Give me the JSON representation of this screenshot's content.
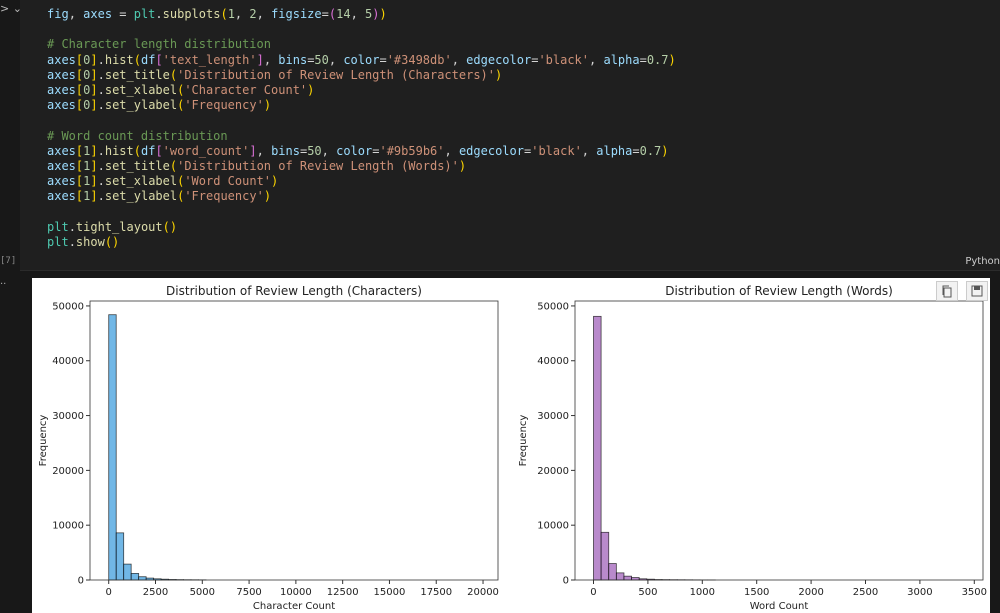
{
  "cell": {
    "execution_count": "[7]",
    "language": "Python",
    "run_glyph": "> ⌄",
    "output_glyph": "..",
    "code_lines": [
      [
        [
          "fig",
          "t-var"
        ],
        [
          ", ",
          "t-op"
        ],
        [
          "axes",
          "t-var"
        ],
        [
          " = ",
          "t-op"
        ],
        [
          "plt",
          "t-mod"
        ],
        [
          ".",
          "t-op"
        ],
        [
          "subplots",
          "t-fn"
        ],
        [
          "(",
          "t-b1"
        ],
        [
          "1",
          "t-num"
        ],
        [
          ", ",
          "t-op"
        ],
        [
          "2",
          "t-num"
        ],
        [
          ", ",
          "t-op"
        ],
        [
          "figsize",
          "t-var"
        ],
        [
          "=",
          "t-op"
        ],
        [
          "(",
          "t-b2"
        ],
        [
          "14",
          "t-num"
        ],
        [
          ", ",
          "t-op"
        ],
        [
          "5",
          "t-num"
        ],
        [
          ")",
          "t-b2"
        ],
        [
          ")",
          "t-b1"
        ]
      ],
      [],
      [
        [
          "# Character length distribution",
          "t-com"
        ]
      ],
      [
        [
          "axes",
          "t-var"
        ],
        [
          "[",
          "t-b1"
        ],
        [
          "0",
          "t-num"
        ],
        [
          "]",
          "t-b1"
        ],
        [
          ".",
          "t-op"
        ],
        [
          "hist",
          "t-fn"
        ],
        [
          "(",
          "t-b1"
        ],
        [
          "df",
          "t-var"
        ],
        [
          "[",
          "t-b2"
        ],
        [
          "'text_length'",
          "t-str"
        ],
        [
          "]",
          "t-b2"
        ],
        [
          ", ",
          "t-op"
        ],
        [
          "bins",
          "t-var"
        ],
        [
          "=",
          "t-op"
        ],
        [
          "50",
          "t-num"
        ],
        [
          ", ",
          "t-op"
        ],
        [
          "color",
          "t-var"
        ],
        [
          "=",
          "t-op"
        ],
        [
          "'#3498db'",
          "t-str"
        ],
        [
          ", ",
          "t-op"
        ],
        [
          "edgecolor",
          "t-var"
        ],
        [
          "=",
          "t-op"
        ],
        [
          "'black'",
          "t-str"
        ],
        [
          ", ",
          "t-op"
        ],
        [
          "alpha",
          "t-var"
        ],
        [
          "=",
          "t-op"
        ],
        [
          "0.7",
          "t-num"
        ],
        [
          ")",
          "t-b1"
        ]
      ],
      [
        [
          "axes",
          "t-var"
        ],
        [
          "[",
          "t-b1"
        ],
        [
          "0",
          "t-num"
        ],
        [
          "]",
          "t-b1"
        ],
        [
          ".",
          "t-op"
        ],
        [
          "set_title",
          "t-fn"
        ],
        [
          "(",
          "t-b1"
        ],
        [
          "'Distribution of Review Length (Characters)'",
          "t-str"
        ],
        [
          ")",
          "t-b1"
        ]
      ],
      [
        [
          "axes",
          "t-var"
        ],
        [
          "[",
          "t-b1"
        ],
        [
          "0",
          "t-num"
        ],
        [
          "]",
          "t-b1"
        ],
        [
          ".",
          "t-op"
        ],
        [
          "set_xlabel",
          "t-fn"
        ],
        [
          "(",
          "t-b1"
        ],
        [
          "'Character Count'",
          "t-str"
        ],
        [
          ")",
          "t-b1"
        ]
      ],
      [
        [
          "axes",
          "t-var"
        ],
        [
          "[",
          "t-b1"
        ],
        [
          "0",
          "t-num"
        ],
        [
          "]",
          "t-b1"
        ],
        [
          ".",
          "t-op"
        ],
        [
          "set_ylabel",
          "t-fn"
        ],
        [
          "(",
          "t-b1"
        ],
        [
          "'Frequency'",
          "t-str"
        ],
        [
          ")",
          "t-b1"
        ]
      ],
      [],
      [
        [
          "# Word count distribution",
          "t-com"
        ]
      ],
      [
        [
          "axes",
          "t-var"
        ],
        [
          "[",
          "t-b1"
        ],
        [
          "1",
          "t-num"
        ],
        [
          "]",
          "t-b1"
        ],
        [
          ".",
          "t-op"
        ],
        [
          "hist",
          "t-fn"
        ],
        [
          "(",
          "t-b1"
        ],
        [
          "df",
          "t-var"
        ],
        [
          "[",
          "t-b2"
        ],
        [
          "'word_count'",
          "t-str"
        ],
        [
          "]",
          "t-b2"
        ],
        [
          ", ",
          "t-op"
        ],
        [
          "bins",
          "t-var"
        ],
        [
          "=",
          "t-op"
        ],
        [
          "50",
          "t-num"
        ],
        [
          ", ",
          "t-op"
        ],
        [
          "color",
          "t-var"
        ],
        [
          "=",
          "t-op"
        ],
        [
          "'#9b59b6'",
          "t-str"
        ],
        [
          ", ",
          "t-op"
        ],
        [
          "edgecolor",
          "t-var"
        ],
        [
          "=",
          "t-op"
        ],
        [
          "'black'",
          "t-str"
        ],
        [
          ", ",
          "t-op"
        ],
        [
          "alpha",
          "t-var"
        ],
        [
          "=",
          "t-op"
        ],
        [
          "0.7",
          "t-num"
        ],
        [
          ")",
          "t-b1"
        ]
      ],
      [
        [
          "axes",
          "t-var"
        ],
        [
          "[",
          "t-b1"
        ],
        [
          "1",
          "t-num"
        ],
        [
          "]",
          "t-b1"
        ],
        [
          ".",
          "t-op"
        ],
        [
          "set_title",
          "t-fn"
        ],
        [
          "(",
          "t-b1"
        ],
        [
          "'Distribution of Review Length (Words)'",
          "t-str"
        ],
        [
          ")",
          "t-b1"
        ]
      ],
      [
        [
          "axes",
          "t-var"
        ],
        [
          "[",
          "t-b1"
        ],
        [
          "1",
          "t-num"
        ],
        [
          "]",
          "t-b1"
        ],
        [
          ".",
          "t-op"
        ],
        [
          "set_xlabel",
          "t-fn"
        ],
        [
          "(",
          "t-b1"
        ],
        [
          "'Word Count'",
          "t-str"
        ],
        [
          ")",
          "t-b1"
        ]
      ],
      [
        [
          "axes",
          "t-var"
        ],
        [
          "[",
          "t-b1"
        ],
        [
          "1",
          "t-num"
        ],
        [
          "]",
          "t-b1"
        ],
        [
          ".",
          "t-op"
        ],
        [
          "set_ylabel",
          "t-fn"
        ],
        [
          "(",
          "t-b1"
        ],
        [
          "'Frequency'",
          "t-str"
        ],
        [
          ")",
          "t-b1"
        ]
      ],
      [],
      [
        [
          "plt",
          "t-mod"
        ],
        [
          ".",
          "t-op"
        ],
        [
          "tight_layout",
          "t-fn"
        ],
        [
          "()",
          "t-b1"
        ]
      ],
      [
        [
          "plt",
          "t-mod"
        ],
        [
          ".",
          "t-op"
        ],
        [
          "show",
          "t-fn"
        ],
        [
          "()",
          "t-b1"
        ]
      ]
    ]
  },
  "output_toolbar": {
    "copy_icon": "copy-icon",
    "save_icon": "save-icon"
  },
  "chart_data": [
    {
      "type": "bar",
      "title": "Distribution of Review Length (Characters)",
      "xlabel": "Character Count",
      "ylabel": "Frequency",
      "color": "#3498db",
      "edgecolor": "#000000",
      "alpha": 0.7,
      "bin_start": 0,
      "bin_width": 400,
      "values": [
        48400,
        8600,
        2900,
        1200,
        600,
        350,
        220,
        150,
        100,
        70,
        50,
        40,
        30
      ],
      "xlim": [
        -1000,
        20800
      ],
      "ylim": [
        0,
        50900
      ],
      "xticks": [
        0,
        2500,
        5000,
        7500,
        10000,
        12500,
        15000,
        17500,
        20000
      ],
      "yticks": [
        0,
        10000,
        20000,
        30000,
        40000,
        50000
      ]
    },
    {
      "type": "bar",
      "title": "Distribution of Review Length (Words)",
      "xlabel": "Word Count",
      "ylabel": "Frequency",
      "color": "#9b59b6",
      "edgecolor": "#000000",
      "alpha": 0.7,
      "bin_start": 0,
      "bin_width": 70,
      "values": [
        48100,
        8700,
        3000,
        1300,
        700,
        450,
        220,
        150,
        90,
        70,
        55,
        45,
        35,
        25,
        10,
        10
      ],
      "xlim": [
        -170,
        3580
      ],
      "ylim": [
        0,
        50900
      ],
      "xticks": [
        0,
        500,
        1000,
        1500,
        2000,
        2500,
        3000,
        3500
      ],
      "yticks": [
        0,
        10000,
        20000,
        30000,
        40000,
        50000
      ]
    }
  ]
}
